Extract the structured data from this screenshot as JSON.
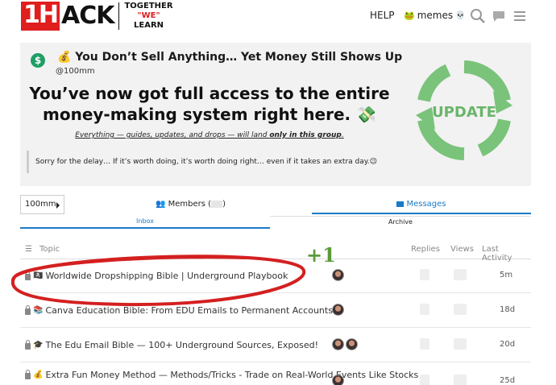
{
  "header": {
    "logo_box": "1H",
    "logo_text": "ACK",
    "tagline": [
      "TOGETHER",
      "\"WE\"",
      "LEARN"
    ],
    "help": "HELP",
    "user": "memes",
    "icons": [
      "search-icon",
      "chat-icon",
      "hamburger-icon"
    ]
  },
  "banner": {
    "title": "💰 You Don’t Sell Anything… Yet Money Still Shows Up",
    "handle": "@100mm",
    "headline": "You’ve now got full access to the entire money-making system right here. 💸",
    "sub_prefix": "Everything — guides, updates, and drops — will land ",
    "sub_bold": "only in this group",
    "sub_suffix": ".",
    "quote": "Sorry for the delay… If it’s worth doing, it’s worth doing right… even if it takes an extra day.😉",
    "badge_text": "UPDATE",
    "colors": {
      "update_green": "#7ac37a",
      "dollar_badge": "#1f9e66"
    }
  },
  "tabs": {
    "group_select": "100mm",
    "members": "Members (",
    "members_suffix": ")",
    "messages": "Messages",
    "inbox": "Inbox",
    "archive": "Archive",
    "accent": "#1a7ac6"
  },
  "table": {
    "headers": {
      "topic": "Topic",
      "replies": "Replies",
      "views": "Views",
      "activity": "Last Activity"
    },
    "rows": [
      {
        "emoji": "🏴‍☠️",
        "title": "Worldwide Dropshipping Bible | Underground Playbook",
        "avatars": 1,
        "activity": "5m"
      },
      {
        "emoji": "📚",
        "title": "Canva Education Bible: From EDU Emails to Permanent Accounts",
        "avatars": 1,
        "activity": "18d"
      },
      {
        "emoji": "🎓",
        "title": "The Edu Email Bible — 100+ Underground Sources, Exposed!",
        "avatars": 2,
        "activity": "20d"
      },
      {
        "emoji": "💰",
        "title": "Extra Fun Money Method — Methods/Tricks - Trade on Real-World Events Like Stocks",
        "avatars": 1,
        "activity": "25d"
      }
    ]
  },
  "annotation": {
    "text": "+1",
    "ellipse_color": "#d42020",
    "text_color": "#5a9a3a"
  }
}
